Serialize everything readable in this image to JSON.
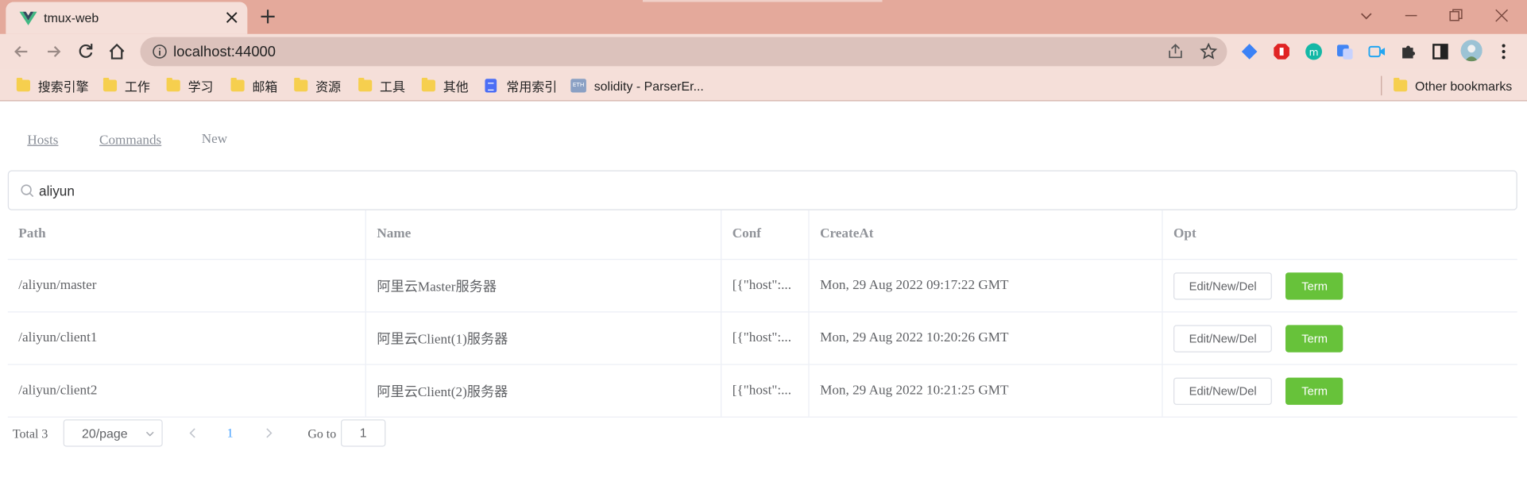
{
  "browser": {
    "tab_title": "tmux-web",
    "url": "localhost:44000",
    "bookmarks": [
      "搜索引擎",
      "工作",
      "学习",
      "邮箱",
      "资源",
      "工具",
      "其他",
      "常用索引",
      "solidity - ParserEr..."
    ],
    "other_bookmarks": "Other bookmarks"
  },
  "nav": {
    "hosts": "Hosts",
    "commands": "Commands",
    "new": "New"
  },
  "search": {
    "value": "aliyun"
  },
  "table": {
    "headers": [
      "Path",
      "Name",
      "Conf",
      "CreateAt",
      "Opt"
    ],
    "rows": [
      {
        "path": "/aliyun/master",
        "name": "阿里云Master服务器",
        "conf": "[{\"host\":...",
        "created": "Mon, 29 Aug 2022 09:17:22 GMT"
      },
      {
        "path": "/aliyun/client1",
        "name": "阿里云Client(1)服务器",
        "conf": "[{\"host\":...",
        "created": "Mon, 29 Aug 2022 10:20:26 GMT"
      },
      {
        "path": "/aliyun/client2",
        "name": "阿里云Client(2)服务器",
        "conf": "[{\"host\":...",
        "created": "Mon, 29 Aug 2022 10:21:25 GMT"
      }
    ],
    "edit_label": "Edit/New/Del",
    "term_label": "Term"
  },
  "pagination": {
    "total": "Total 3",
    "page_size": "20/page",
    "current_page": "1",
    "goto_label": "Go to",
    "goto_value": "1"
  },
  "colors": {
    "term_button": "#67c23a",
    "active_page": "#409eff",
    "tabstrip": "#e4a99b"
  }
}
